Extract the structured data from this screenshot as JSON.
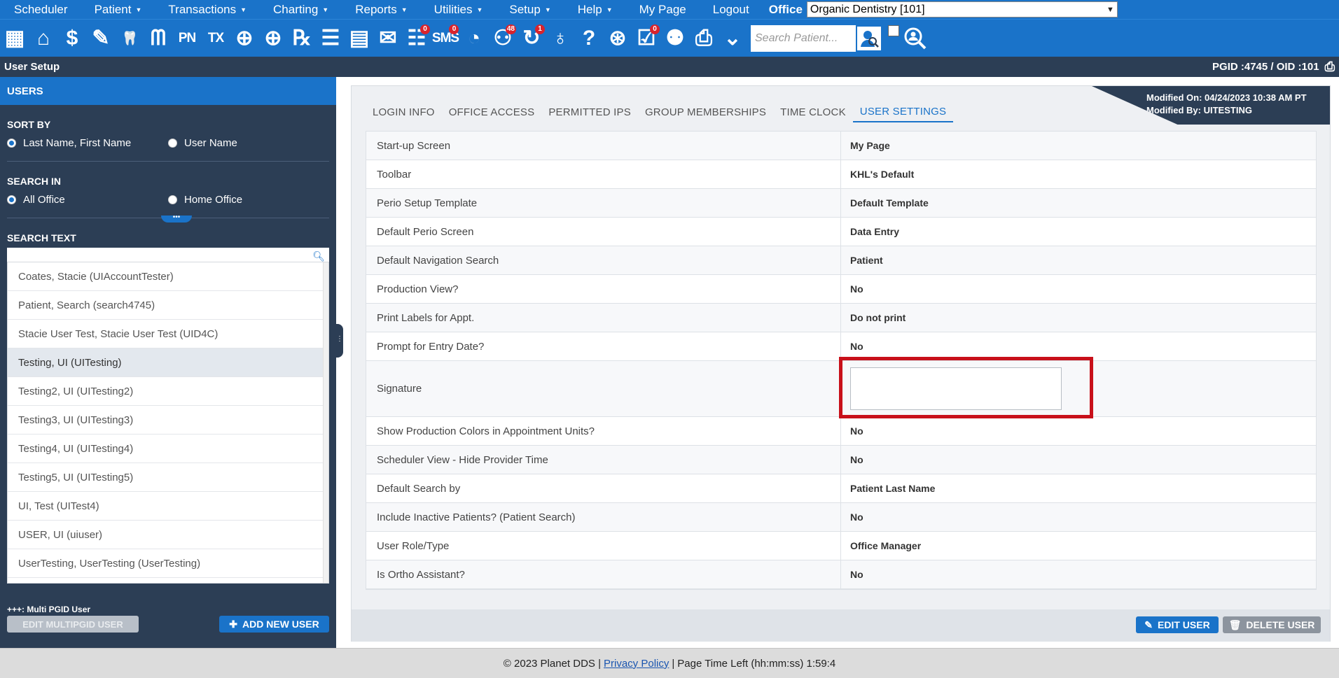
{
  "menu": {
    "items": [
      {
        "label": "Scheduler",
        "caret": false
      },
      {
        "label": "Patient",
        "caret": true
      },
      {
        "label": "Transactions",
        "caret": true
      },
      {
        "label": "Charting",
        "caret": true
      },
      {
        "label": "Reports",
        "caret": true
      },
      {
        "label": "Utilities",
        "caret": true
      },
      {
        "label": "Setup",
        "caret": true
      },
      {
        "label": "Help",
        "caret": true
      },
      {
        "label": "My Page",
        "caret": false
      },
      {
        "label": "Logout",
        "caret": false
      }
    ],
    "office_label": "Office",
    "office_value": "Organic Dentistry [101]"
  },
  "toolbar": {
    "icons": [
      {
        "name": "calendar-icon",
        "glyph": "▦"
      },
      {
        "name": "home-icon",
        "glyph": "⌂"
      },
      {
        "name": "dollar-icon",
        "glyph": "$"
      },
      {
        "name": "pencil-icon",
        "glyph": "✎"
      },
      {
        "name": "tooth-chart-icon",
        "glyph": "🦷"
      },
      {
        "name": "tooth-perio-icon",
        "glyph": "ᗰ"
      },
      {
        "name": "pn-icon",
        "glyph": "PN"
      },
      {
        "name": "tx-icon",
        "glyph": "TX"
      },
      {
        "name": "add-patient-icon",
        "glyph": "⊕"
      },
      {
        "name": "add-family-icon",
        "glyph": "⊕"
      },
      {
        "name": "rx-icon",
        "glyph": "℞"
      },
      {
        "name": "notes-icon",
        "glyph": "☰"
      },
      {
        "name": "document-icon",
        "glyph": "▤"
      },
      {
        "name": "mail-icon",
        "glyph": "✉"
      },
      {
        "name": "chat-icon",
        "glyph": "☷",
        "badge": "0"
      },
      {
        "name": "sms-icon",
        "glyph": "SMS",
        "badge": "0"
      },
      {
        "name": "clock-icon",
        "glyph": "◔"
      },
      {
        "name": "recall-icon",
        "glyph": "⚇",
        "badge": "48"
      },
      {
        "name": "sync-icon",
        "glyph": "↻",
        "badge": "1"
      },
      {
        "name": "tooth-icon",
        "glyph": "♁"
      },
      {
        "name": "help-tooth-icon",
        "glyph": "?"
      },
      {
        "name": "globe-icon",
        "glyph": "⊛"
      },
      {
        "name": "checklist-icon",
        "glyph": "☑",
        "badge": "0"
      },
      {
        "name": "group-icon",
        "glyph": "⚉"
      },
      {
        "name": "printer-icon",
        "glyph": "⎙"
      },
      {
        "name": "expand-icon",
        "glyph": "⌄"
      }
    ],
    "search_placeholder": "Search Patient...",
    "search_icon": "patient-search-icon",
    "advanced_search_icon": "advanced-search-icon"
  },
  "header": {
    "title": "User Setup",
    "ids": "PGID :4745  /  OID :101"
  },
  "sidebar": {
    "title": "USERS",
    "sort_by_label": "SORT BY",
    "sort_options": [
      {
        "label": "Last Name, First Name",
        "checked": true
      },
      {
        "label": "User Name",
        "checked": false
      }
    ],
    "search_in_label": "SEARCH IN",
    "search_in_options": [
      {
        "label": "All Office",
        "checked": true
      },
      {
        "label": "Home Office",
        "checked": false
      }
    ],
    "handle_dots": "•••",
    "search_text_label": "SEARCH TEXT",
    "users": [
      {
        "label": "Coates, Stacie (UIAccountTester)",
        "selected": false
      },
      {
        "label": "Patient, Search (search4745)",
        "selected": false
      },
      {
        "label": "Stacie User Test, Stacie User Test (UID4C)",
        "selected": false
      },
      {
        "label": "Testing, UI (UITesting)",
        "selected": true
      },
      {
        "label": "Testing2, UI (UITesting2)",
        "selected": false
      },
      {
        "label": "Testing3, UI (UITesting3)",
        "selected": false
      },
      {
        "label": "Testing4, UI (UITesting4)",
        "selected": false
      },
      {
        "label": "Testing5, UI (UITesting5)",
        "selected": false
      },
      {
        "label": "UI, Test (UITest4)",
        "selected": false
      },
      {
        "label": "USER, UI (uiuser)",
        "selected": false
      },
      {
        "label": "UserTesting, UserTesting (UserTesting)",
        "selected": false
      }
    ],
    "multi_note": "+++: Multi PGID User",
    "edit_multi_label": "EDIT MULTIPGID USER",
    "add_user_label": "ADD NEW USER"
  },
  "tabs": [
    {
      "label": "LOGIN INFO",
      "active": false
    },
    {
      "label": "OFFICE ACCESS",
      "active": false
    },
    {
      "label": "PERMITTED IPS",
      "active": false
    },
    {
      "label": "GROUP MEMBERSHIPS",
      "active": false
    },
    {
      "label": "TIME CLOCK",
      "active": false
    },
    {
      "label": "USER SETTINGS",
      "active": true
    }
  ],
  "modified": {
    "on": "Modified On: 04/24/2023 10:38 AM PT",
    "by": "Modified By: UITESTING"
  },
  "settings": [
    {
      "label": "Start-up Screen",
      "value": "My Page"
    },
    {
      "label": "Toolbar",
      "value": "KHL's Default"
    },
    {
      "label": "Perio Setup Template",
      "value": "Default Template"
    },
    {
      "label": "Default Perio Screen",
      "value": "Data Entry"
    },
    {
      "label": "Default Navigation Search",
      "value": "Patient"
    },
    {
      "label": "Production View?",
      "value": "No"
    },
    {
      "label": "Print Labels for Appt.",
      "value": "Do not print"
    },
    {
      "label": "Prompt for Entry Date?",
      "value": "No"
    },
    {
      "label": "Signature",
      "value": "",
      "signature": true
    },
    {
      "label": "Show Production Colors in Appointment Units?",
      "value": "No"
    },
    {
      "label": "Scheduler View - Hide Provider Time",
      "value": "No"
    },
    {
      "label": "Default Search by",
      "value": "Patient Last Name"
    },
    {
      "label": "Include Inactive Patients? (Patient Search)",
      "value": "No"
    },
    {
      "label": "User Role/Type",
      "value": "Office Manager"
    },
    {
      "label": "Is Ortho Assistant?",
      "value": "No"
    }
  ],
  "actions": {
    "edit_user": "EDIT USER",
    "delete_user": "DELETE USER"
  },
  "footer": {
    "copyright": "© 2023 Planet DDS |",
    "privacy": "Privacy Policy",
    "sep": "|",
    "time_left": " Page Time Left (hh:mm:ss) 1:59:4"
  },
  "colors": {
    "brand_blue": "#1a73c9",
    "navy": "#2c3e55",
    "highlight_red": "#c8101a"
  }
}
